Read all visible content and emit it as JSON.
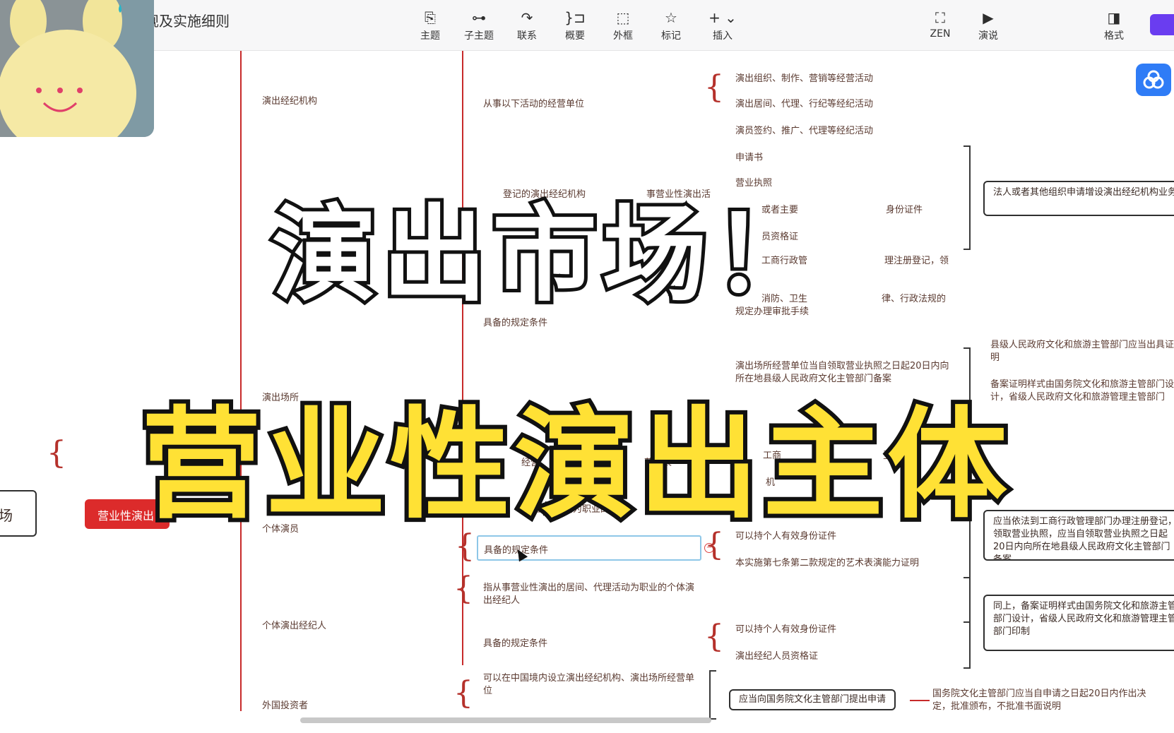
{
  "doc_title": "规及实施细则",
  "toolbar": [
    {
      "icon": "topic-icon",
      "glyph": "⎘",
      "label": "主题"
    },
    {
      "icon": "subtopic-icon",
      "glyph": "⊶",
      "label": "子主题"
    },
    {
      "icon": "relationship-icon",
      "glyph": "↷",
      "label": "联系"
    },
    {
      "icon": "summary-icon",
      "glyph": "}⊐",
      "label": "概要"
    },
    {
      "icon": "boundary-icon",
      "glyph": "⬚",
      "label": "外框"
    },
    {
      "icon": "marker-star-icon",
      "glyph": "☆",
      "label": "标记"
    },
    {
      "icon": "insert-plus-icon",
      "glyph": "+ ⌄",
      "label": "插入"
    },
    {
      "icon": "zen-mode-icon",
      "glyph": "⛶",
      "label": "ZEN"
    },
    {
      "icon": "presentation-icon",
      "glyph": "▶",
      "label": "演说"
    },
    {
      "icon": "format-panel-icon",
      "glyph": "◨",
      "label": "格式"
    }
  ],
  "mindmap": {
    "root_fragment": "场",
    "central_topic": "营业性演出",
    "level1": {
      "agency": "演出经纪机构",
      "venue": "演出场所",
      "individual_performer": "个体演员",
      "individual_broker": "个体演出经纪人",
      "foreign_investor": "外国投资者"
    },
    "level2": {
      "agency_activities": "从事以下活动的经营单位",
      "registered_agency": "登记的演出经纪机构",
      "registered_agency_tail": "事营业性演出活",
      "venue_conditions": "具备的规定条件",
      "venue_operator": "经营",
      "venue_art": "艺术表",
      "venue_individual": "营业性演出为职业的个",
      "performer_conditions": "具备的规定条件",
      "broker_definition": "指从事营业性演出的居间、代理活动为职业的个体演出经纪人",
      "broker_conditions": "具备的规定条件",
      "foreign_definition": "可以在中国境内设立演出经纪机构、演出场所经营单位"
    },
    "level3": {
      "act1": "演出组织、制作、营销等经营活动",
      "act2": "演出居间、代理、行纪等经纪活动",
      "act3": "演员签约、推广、代理等经纪活动",
      "app": "申请书",
      "license": "营业执照",
      "id_tail": "或者主要",
      "id_end": "身份证件",
      "qual": "员资格证",
      "commerce": "工商行政管",
      "commerce_tail": "理注册登记，领",
      "fire": "消防、卫生",
      "fire_tail": "律、行政法规的",
      "fire_line2": "规定办理审批手续",
      "venue_filing": "演出场所经营单位当自领取营业执照之日起20日内向所在地县级人民政府文化主管部门备案",
      "venue_reg": "工商",
      "venue_reg_tail": "登",
      "venue_org": "机",
      "perf_id": "可以持个人有效身份证件",
      "perf_cert": "本实施第七条第二款规定的艺术表演能力证明",
      "broker_id": "可以持个人有效身份证件",
      "broker_qual": "演出经纪人员资格证",
      "foreign_apply": "应当向国务院文化主管部门提出申请"
    },
    "level4": {
      "legal_person": "法人或者其他组织申请增设演出经纪机构业务的，应该提交前款第一项、第四项规定",
      "county_cert": "县级人民政府文化和旅游主管部门应当出具证明",
      "cert_form": "备案证明样式由国务院文化和旅游主管部门设计，省级人民政府文化和旅游管理主管部门",
      "performer_reg": "应当依法到工商行政管理部门办理注册登记，领取营业执照，应当自领取营业执照之日起20日内向所在地县级人民政府文化主管部门备案",
      "broker_same": "同上，备案证明样式由国务院文化和旅游主管部门设计，省级人民政府文化和旅游管理主管部门印制",
      "foreign_decision": "国务院文化主管部门应当自申请之日起20日内作出决定，批准颁布，不批准书面说明"
    }
  },
  "overlay": {
    "line1": "演出市场！",
    "line2": "营业性演出主体"
  },
  "colors": {
    "branch_line": "#c72a2a",
    "central_topic_bg": "#dc2b2b",
    "overlay_yellow": "#ffe135",
    "cloud_button": "#2f7cf6",
    "accent_button": "#6a3df0"
  }
}
